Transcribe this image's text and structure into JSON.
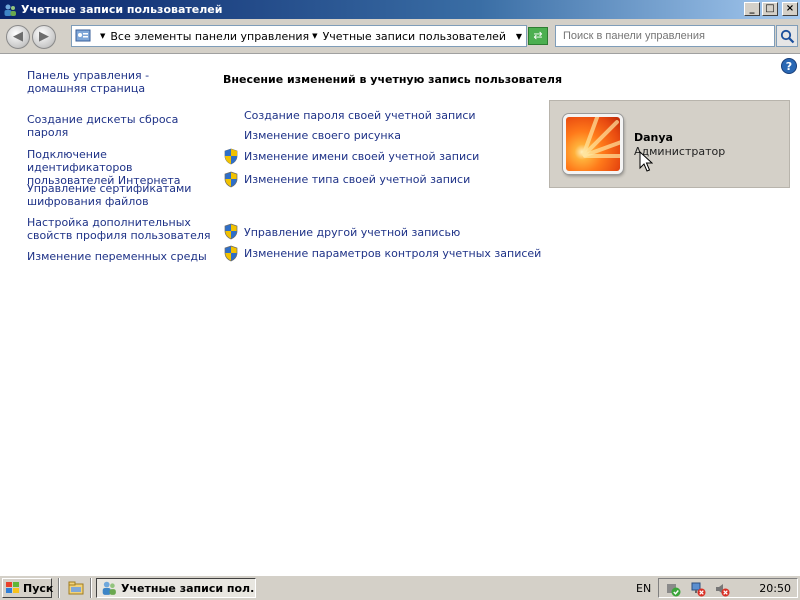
{
  "window": {
    "title": "Учетные записи пользователей",
    "controls": {
      "minimize": "_",
      "maximize": "□",
      "close": "×"
    }
  },
  "address_bar": {
    "crumbs": [
      "Все элементы панели управления",
      "Учетные записи пользователей"
    ],
    "search_placeholder": "Поиск в панели управления"
  },
  "left_nav": [
    "Панель управления - домашняя страница",
    "Создание дискеты сброса пароля",
    "Подключение идентификаторов пользователей Интернета",
    "Управление сертификатами шифрования файлов",
    "Настройка дополнительных свойств профиля пользователя",
    "Изменение переменных среды"
  ],
  "main": {
    "heading": "Внесение изменений в учетную запись пользователя",
    "tasks": [
      {
        "label": "Создание пароля своей учетной записи",
        "shield": false
      },
      {
        "label": "Изменение своего рисунка",
        "shield": false
      },
      {
        "label": "Изменение имени своей учетной записи",
        "shield": true
      },
      {
        "label": "Изменение типа своей учетной записи",
        "shield": true
      },
      {
        "label": "Управление другой учетной записью",
        "shield": true
      },
      {
        "label": "Изменение параметров контроля учетных записей",
        "shield": true
      }
    ]
  },
  "user": {
    "name": "Danya",
    "role": "Администратор"
  },
  "taskbar": {
    "start_label": "Пуск",
    "window_button": "Учетные записи пол...",
    "language": "EN",
    "clock": "20:50"
  },
  "icons": [
    "users-icon",
    "control-panel-icon",
    "search-icon",
    "help-icon",
    "uac-shield-icon",
    "start-flag-icon",
    "quick-launch-icon",
    "network-icon",
    "volume-icon"
  ],
  "colors": {
    "link": "#1e3287",
    "title_bar": "#0a246a",
    "card_bg": "#d4d0c8"
  }
}
